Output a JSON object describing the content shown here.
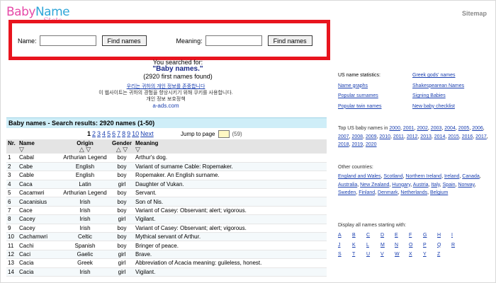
{
  "brand": {
    "main_pre": "Baby",
    "main_post": "Name",
    "sub": "Stats"
  },
  "header": {
    "sitemap": "Sitemap"
  },
  "search": {
    "name_label": "Name:",
    "name_value": "",
    "name_button": "Find names",
    "meaning_label": "Meaning:",
    "meaning_value": "",
    "meaning_button": "Find names"
  },
  "info": {
    "searched_for": "You searched for:",
    "query": "\"Baby names.\"",
    "found": "(2920 first names found)"
  },
  "ad": {
    "line1": "우리는 귀하의 개인 정보를 존중합니다",
    "line2": "이 웹사이트는 귀하의 경험을 향상시키기 위해 쿠키를 사용합니다.",
    "line3": "개인 정보 보호정책",
    "source": "a-ads.com"
  },
  "results": {
    "title": "Baby names - Search results: 2920 names (1-50)",
    "pages": [
      "1",
      "2",
      "3",
      "4",
      "5",
      "6",
      "7",
      "8",
      "9",
      "10"
    ],
    "current_page": "1",
    "next": "Next",
    "jump_label": "Jump to page",
    "page_count": "(59)",
    "columns": {
      "nr": "Nr.",
      "name": "Name",
      "origin": "Origin",
      "gender": "Gender",
      "meaning": "Meaning"
    },
    "sort_down": "▽",
    "sort_both": "△ ▽",
    "rows": [
      {
        "nr": "1",
        "name": "Cabal",
        "origin": "Arthurian Legend",
        "gender": "boy",
        "meaning": "Arthur's dog."
      },
      {
        "nr": "2",
        "name": "Cabe",
        "origin": "English",
        "gender": "boy",
        "meaning": "Variant of surname Cable: Ropemaker."
      },
      {
        "nr": "3",
        "name": "Cable",
        "origin": "English",
        "gender": "boy",
        "meaning": "Ropemaker. An English surname."
      },
      {
        "nr": "4",
        "name": "Caca",
        "origin": "Latin",
        "gender": "girl",
        "meaning": "Daughter of Vukan."
      },
      {
        "nr": "5",
        "name": "Cacamwri",
        "origin": "Arthurian Legend",
        "gender": "boy",
        "meaning": "Servant."
      },
      {
        "nr": "6",
        "name": "Cacanisius",
        "origin": "Irish",
        "gender": "boy",
        "meaning": "Son of Nis."
      },
      {
        "nr": "7",
        "name": "Cace",
        "origin": "Irish",
        "gender": "boy",
        "meaning": "Variant of Casey: Observant; alert; vigorous."
      },
      {
        "nr": "8",
        "name": "Cacey",
        "origin": "Irish",
        "gender": "girl",
        "meaning": "Vigilant."
      },
      {
        "nr": "9",
        "name": "Cacey",
        "origin": "Irish",
        "gender": "boy",
        "meaning": "Variant of Casey: Observant; alert; vigorous."
      },
      {
        "nr": "10",
        "name": "Cachamwri",
        "origin": "Celtic",
        "gender": "boy",
        "meaning": "Mythical servant of Arthur."
      },
      {
        "nr": "11",
        "name": "Cachi",
        "origin": "Spanish",
        "gender": "boy",
        "meaning": "Bringer of peace."
      },
      {
        "nr": "12",
        "name": "Caci",
        "origin": "Gaelic",
        "gender": "girl",
        "meaning": "Brave."
      },
      {
        "nr": "13",
        "name": "Cacia",
        "origin": "Greek",
        "gender": "girl",
        "meaning": "Abbreviation of Acacia meaning: guileless, honest."
      },
      {
        "nr": "14",
        "name": "Cacia",
        "origin": "Irish",
        "gender": "girl",
        "meaning": "Vigilant."
      }
    ]
  },
  "sidebar": {
    "stats_title": "US name statistics:",
    "stats_links": [
      "Greek gods' names",
      "Name graphs",
      "Shakespearean Names",
      "Popular surnames",
      "Signing Babies",
      "Popular twin names",
      "New baby checklist"
    ],
    "top_title": "Top US baby names in",
    "years": [
      "2000",
      "2001",
      "2002",
      "2003",
      "2004",
      "2005",
      "2006",
      "2007",
      "2008",
      "2009",
      "2010",
      "2011",
      "2012",
      "2013",
      "2014",
      "2015",
      "2016",
      "2017",
      "2018",
      "2019",
      "2020"
    ],
    "other_title": "Other countries:",
    "countries": [
      "England and Wales",
      "Scotland",
      "Northern Ireland",
      "Ireland",
      "Canada",
      "Australia",
      "New Zealand",
      "Hungary",
      "Austria",
      "Italy",
      "Spain",
      "Norway",
      "Sweden",
      "Finland",
      "Denmark",
      "Netherlands",
      "Belgium"
    ],
    "display_title": "Display all names starting with:",
    "letters": [
      "A",
      "B",
      "C",
      "D",
      "E",
      "F",
      "G",
      "H",
      "I",
      "J",
      "K",
      "L",
      "M",
      "N",
      "O",
      "P",
      "Q",
      "R",
      "S",
      "T",
      "U",
      "V",
      "W",
      "X",
      "Y",
      "Z"
    ]
  },
  "colors": {
    "highlight_border": "#e8141e",
    "results_header": "#cfeef8",
    "link": "#1a3fb0",
    "jump_box": "#fff8c4"
  }
}
